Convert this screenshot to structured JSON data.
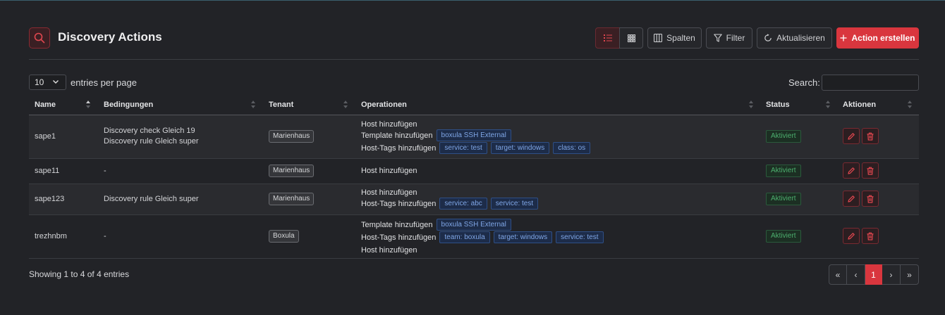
{
  "header": {
    "title": "Discovery Actions",
    "buttons": {
      "columns": "Spalten",
      "filter": "Filter",
      "refresh": "Aktualisieren",
      "create": "Action erstellen"
    }
  },
  "length": {
    "value": "10",
    "label": "entries per page"
  },
  "search": {
    "label": "Search:",
    "value": ""
  },
  "columns": [
    "Name",
    "Bedingungen",
    "Tenant",
    "Operationen",
    "Status",
    "Aktionen"
  ],
  "rows": [
    {
      "name": "sape1",
      "conditions": [
        "Discovery check Gleich 19",
        "Discovery rule Gleich super"
      ],
      "tenant": "Marienhaus",
      "operations": [
        {
          "label": "Host hinzufügen",
          "tags": []
        },
        {
          "label": "Template hinzufügen",
          "tags": [
            "boxula SSH External"
          ]
        },
        {
          "label": "Host-Tags hinzufügen",
          "tags": [
            "service: test",
            "target: windows",
            "class: os"
          ]
        }
      ],
      "status": "Aktiviert"
    },
    {
      "name": "sape11",
      "conditions": [
        "-"
      ],
      "tenant": "Marienhaus",
      "operations": [
        {
          "label": "Host hinzufügen",
          "tags": []
        }
      ],
      "status": "Aktiviert"
    },
    {
      "name": "sape123",
      "conditions": [
        "Discovery rule Gleich super"
      ],
      "tenant": "Marienhaus",
      "operations": [
        {
          "label": "Host hinzufügen",
          "tags": []
        },
        {
          "label": "Host-Tags hinzufügen",
          "tags": [
            "service: abc",
            "service: test"
          ]
        }
      ],
      "status": "Aktiviert"
    },
    {
      "name": "trezhnbm",
      "conditions": [
        "-"
      ],
      "tenant": "Boxula",
      "operations": [
        {
          "label": "Template hinzufügen",
          "tags": [
            "boxula SSH External"
          ]
        },
        {
          "label": "Host-Tags hinzufügen",
          "tags": [
            "team: boxula",
            "target: windows",
            "service: test"
          ]
        },
        {
          "label": "Host hinzufügen",
          "tags": []
        }
      ],
      "status": "Aktiviert"
    }
  ],
  "footer": {
    "info": "Showing 1 to 4 of 4 entries",
    "pagination": {
      "first": "«",
      "prev": "‹",
      "current": "1",
      "next": "›",
      "last": "»"
    }
  },
  "icons": {
    "title": "search-icon",
    "list_view": "list-icon",
    "grid_view": "grid-icon",
    "columns": "columns-icon",
    "filter": "filter-icon",
    "refresh": "refresh-icon",
    "create": "plus-icon",
    "edit": "pencil-icon",
    "delete": "trash-icon"
  },
  "colors": {
    "accent": "#d9363e",
    "tag": "#7fa6e6",
    "status": "#4caf6e"
  }
}
